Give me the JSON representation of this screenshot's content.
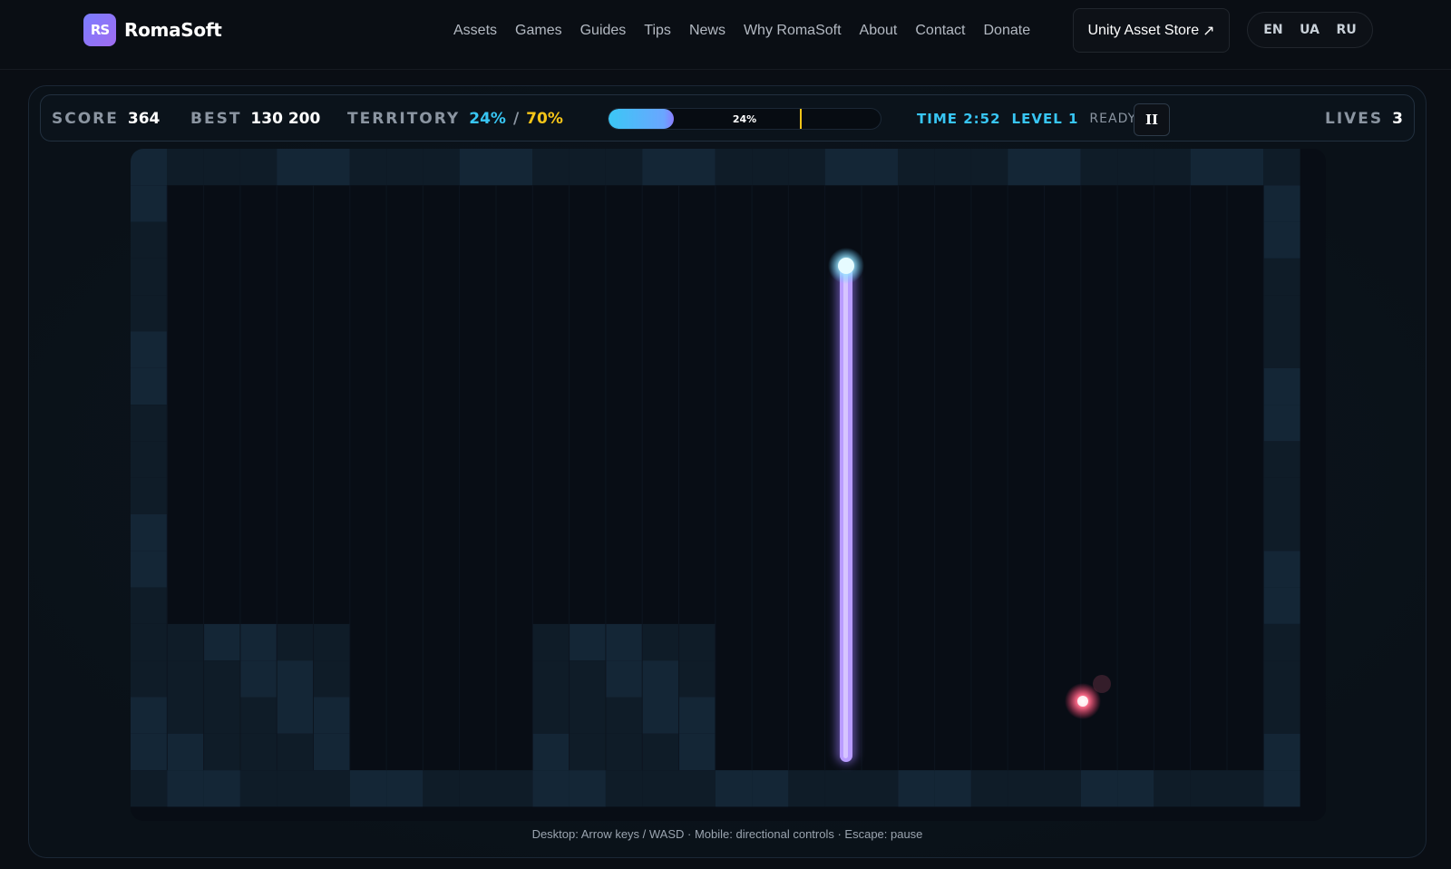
{
  "header": {
    "logo_mark": "RS",
    "brand": "RomaSoft",
    "nav": [
      "Assets",
      "Games",
      "Guides",
      "Tips",
      "News",
      "Why RomaSoft",
      "About",
      "Contact",
      "Donate"
    ],
    "store_button": "Unity Asset Store",
    "store_icon": "↗",
    "languages": [
      "EN",
      "UA",
      "RU"
    ]
  },
  "hud": {
    "score_label": "SCORE",
    "score": "364",
    "best_label": "BEST",
    "best": "130 200",
    "territory_label": "TERRITORY",
    "territory_current": "24%",
    "territory_separator": "/",
    "territory_target": "70%",
    "progress_text": "24%",
    "progress_fraction": 0.24,
    "target_fraction": 0.7,
    "time": "TIME 2:52",
    "level": "LEVEL 1",
    "status": "READY",
    "pause_symbol": "II",
    "lives_label": "LIVES",
    "lives": "3"
  },
  "board": {
    "wall_color": "#0f1c28",
    "wall_alt_color": "#142636",
    "open_color": "#080d15",
    "trail_color": "#b99cff",
    "player_color": "#e6fbff",
    "enemy_color": "#ff6b8a"
  },
  "footer": {
    "hint": "Desktop: Arrow keys / WASD · Mobile: directional controls · Escape: pause"
  }
}
